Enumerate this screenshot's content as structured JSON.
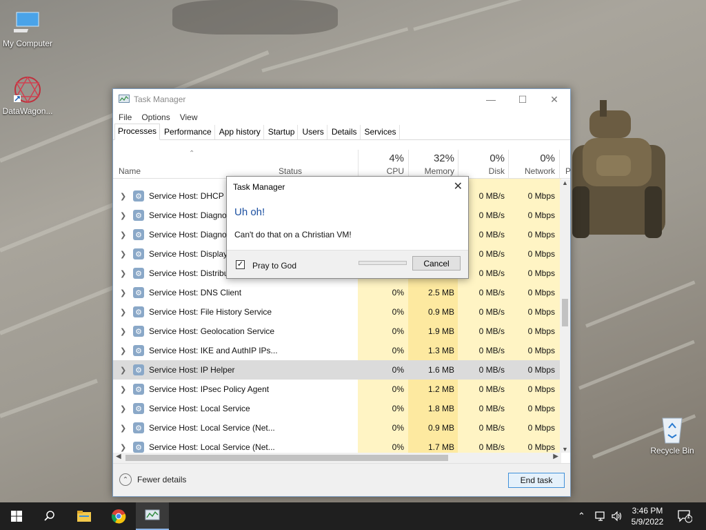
{
  "desktop": {
    "icons": [
      {
        "label": "My Computer",
        "icon": "computer-icon"
      },
      {
        "label": "DataWagon...",
        "icon": "datawagon-icon"
      },
      {
        "label": "Recycle Bin",
        "icon": "recycle-bin-icon"
      }
    ]
  },
  "window": {
    "title": "Task Manager",
    "menu": [
      "File",
      "Options",
      "View"
    ],
    "tabs": [
      "Processes",
      "Performance",
      "App history",
      "Startup",
      "Users",
      "Details",
      "Services"
    ],
    "active_tab": "Processes",
    "columns": {
      "name": "Name",
      "status": "Status",
      "cpu": {
        "label": "CPU",
        "pct": "4%"
      },
      "memory": {
        "label": "Memory",
        "pct": "32%"
      },
      "disk": {
        "label": "Disk",
        "pct": "0%"
      },
      "network": {
        "label": "Network",
        "pct": "0%"
      },
      "power": "P"
    },
    "rows": [
      {
        "name": "Service Host: DHCP Client",
        "cpu": "",
        "mem": "",
        "disk": "0 MB/s",
        "net": "0 Mbps"
      },
      {
        "name": "Service Host: Diagnostic Policy Service",
        "cpu": "",
        "mem": "",
        "disk": "0 MB/s",
        "net": "0 Mbps"
      },
      {
        "name": "Service Host: Diagnostic System Host",
        "cpu": "",
        "mem": "",
        "disk": "0 MB/s",
        "net": "0 Mbps"
      },
      {
        "name": "Service Host: Display Policy Service",
        "cpu": "",
        "mem": "",
        "disk": "0 MB/s",
        "net": "0 Mbps"
      },
      {
        "name": "Service Host: Distributed Link Tracking",
        "cpu": "",
        "mem": "",
        "disk": "0 MB/s",
        "net": "0 Mbps"
      },
      {
        "name": "Service Host: DNS Client",
        "cpu": "0%",
        "mem": "2.5 MB",
        "disk": "0 MB/s",
        "net": "0 Mbps"
      },
      {
        "name": "Service Host: File History Service",
        "cpu": "0%",
        "mem": "0.9 MB",
        "disk": "0 MB/s",
        "net": "0 Mbps"
      },
      {
        "name": "Service Host: Geolocation Service",
        "cpu": "0%",
        "mem": "1.9 MB",
        "disk": "0 MB/s",
        "net": "0 Mbps"
      },
      {
        "name": "Service Host: IKE and AuthIP IPs...",
        "cpu": "0%",
        "mem": "1.3 MB",
        "disk": "0 MB/s",
        "net": "0 Mbps"
      },
      {
        "name": "Service Host: IP Helper",
        "cpu": "0%",
        "mem": "1.6 MB",
        "disk": "0 MB/s",
        "net": "0 Mbps",
        "selected": true
      },
      {
        "name": "Service Host: IPsec Policy Agent",
        "cpu": "0%",
        "mem": "1.2 MB",
        "disk": "0 MB/s",
        "net": "0 Mbps"
      },
      {
        "name": "Service Host: Local Service",
        "cpu": "0%",
        "mem": "1.8 MB",
        "disk": "0 MB/s",
        "net": "0 Mbps"
      },
      {
        "name": "Service Host: Local Service (Net...",
        "cpu": "0%",
        "mem": "0.9 MB",
        "disk": "0 MB/s",
        "net": "0 Mbps"
      },
      {
        "name": "Service Host: Local Service (Net...",
        "cpu": "0%",
        "mem": "1.7 MB",
        "disk": "0 MB/s",
        "net": "0 Mbps"
      }
    ],
    "footer": {
      "fewer_details": "Fewer details",
      "end_task": "End task"
    }
  },
  "dialog": {
    "title": "Task Manager",
    "heading": "Uh oh!",
    "message": "Can't do that on a Christian VM!",
    "checkbox_label": "Pray to God",
    "checkbox_checked": true,
    "cancel": "Cancel"
  },
  "taskbar": {
    "time": "3:46 PM",
    "date": "5/9/2022",
    "notification_count": "1",
    "items": [
      "start-icon",
      "search-icon",
      "file-explorer-icon",
      "chrome-icon",
      "task-manager-icon"
    ]
  }
}
